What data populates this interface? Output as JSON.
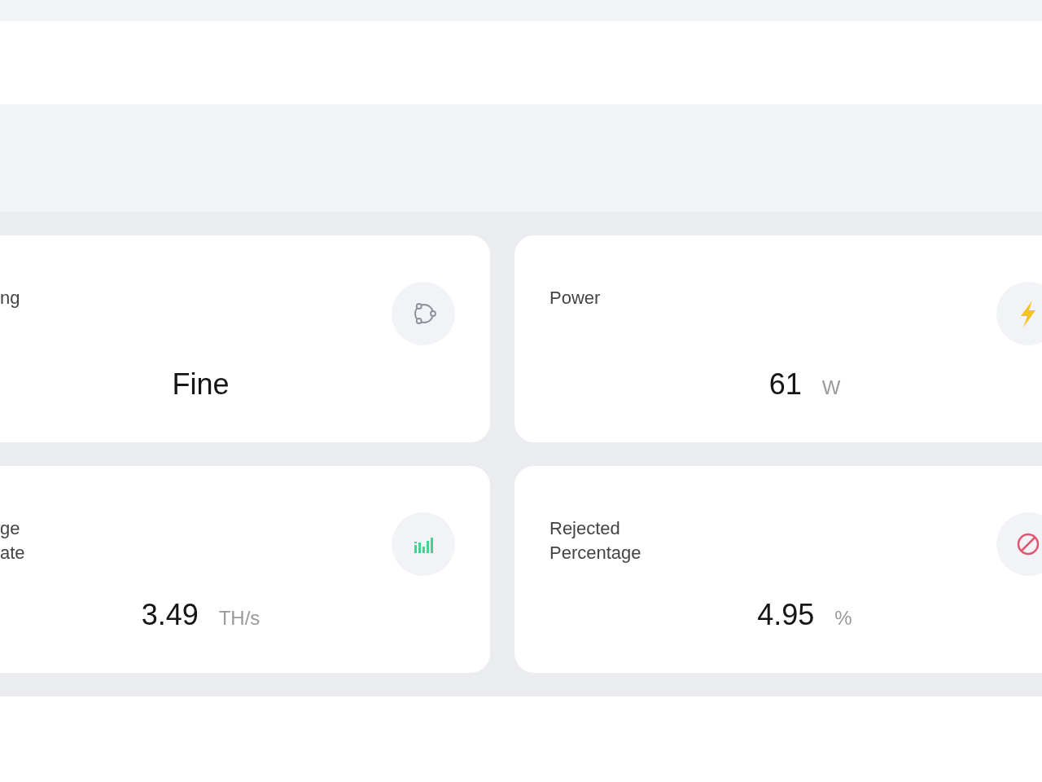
{
  "cards": [
    {
      "label": "ng",
      "value": "Fine"
    },
    {
      "label": "Power",
      "value": "61",
      "unit": "W"
    },
    {
      "label": "ge\nate",
      "value": "3.49",
      "unit": "TH/s"
    },
    {
      "label": "Rejected\nPercentage",
      "value": "4.95",
      "unit": "%"
    }
  ]
}
